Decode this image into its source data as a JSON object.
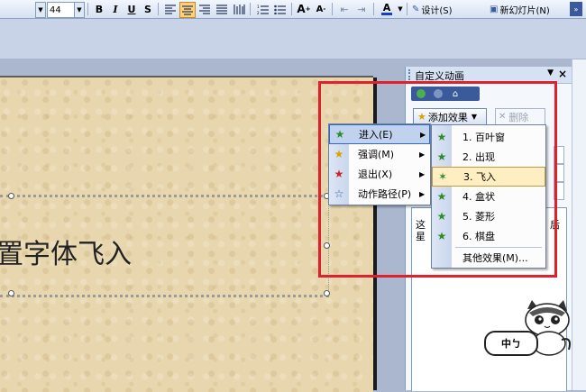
{
  "toolbar": {
    "font_size": "44",
    "bold": "B",
    "italic": "I",
    "underline": "U",
    "shadow": "S",
    "font_grow": "A",
    "font_shrink": "A",
    "font_color": "A",
    "design_label": "设计(S)",
    "new_slide_label": "新幻灯片(N)"
  },
  "slide": {
    "text": "置字体飞入"
  },
  "task_pane": {
    "title": "自定义动画",
    "add_effect_label": "添加效果",
    "delete_label": "删除",
    "description_line1": "这",
    "description_line2": "星",
    "description_right": "后"
  },
  "effect_menu": {
    "items": [
      {
        "label": "进入(E)",
        "icon": "green-star-icon",
        "color": "#2d8a2d"
      },
      {
        "label": "强调(M)",
        "icon": "yellow-star-icon",
        "color": "#d8a200"
      },
      {
        "label": "退出(X)",
        "icon": "red-star-icon",
        "color": "#c8232b"
      },
      {
        "label": "动作路径(P)",
        "icon": "outline-star-icon",
        "color": "#3a5a9c"
      }
    ]
  },
  "entrance_submenu": {
    "items": [
      {
        "label": "1. 百叶窗"
      },
      {
        "label": "2. 出现"
      },
      {
        "label": "3. 飞入"
      },
      {
        "label": "4. 盒状"
      },
      {
        "label": "5. 菱形"
      },
      {
        "label": "6. 棋盘"
      }
    ],
    "more_label": "其他效果(M)...",
    "selected_index": 2
  },
  "sticker": {
    "text": "中ㄅ"
  },
  "colors": {
    "annotation_red": "#e0202a",
    "menu_highlight": "#c1d2ee",
    "submenu_highlight": "#ffeec2"
  }
}
